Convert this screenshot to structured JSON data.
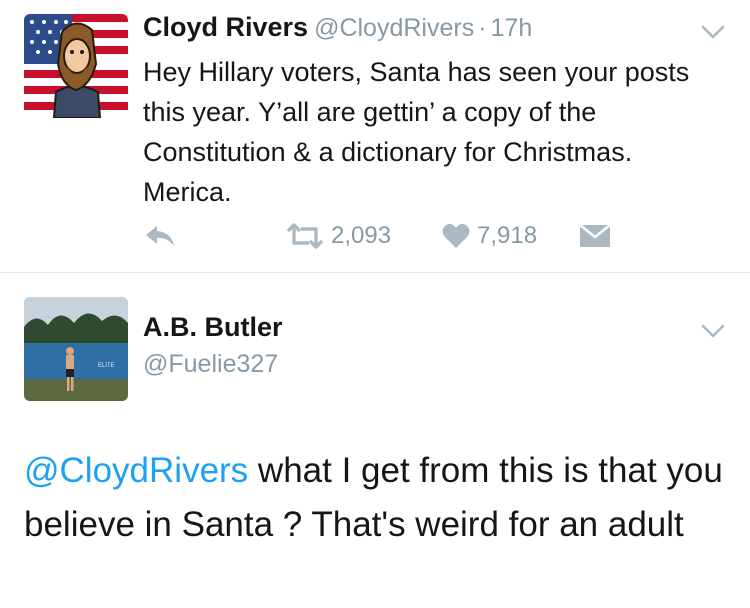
{
  "tweet": {
    "name": "Cloyd Rivers",
    "handle": "@CloydRivers",
    "separator": "·",
    "time": "17h",
    "text": "Hey Hillary voters, Santa has seen your posts this year. Y’all are gettin’ a copy of the Constitution & a dictionary for Christmas. Merica.",
    "actions": {
      "reply_icon": "reply-icon",
      "retweet_icon": "retweet-icon",
      "retweet_count": "2,093",
      "like_icon": "heart-icon",
      "like_count": "7,918",
      "dm_icon": "envelope-icon"
    }
  },
  "reply": {
    "name": "A.B. Butler",
    "handle": "@Fuelie327",
    "mention": "@CloydRivers",
    "text": " what I get from this is that you believe in Santa ? That's weird for an adult"
  },
  "colors": {
    "link": "#1da1f2",
    "secondary": "#8899a6",
    "divider": "#e1e8ed"
  }
}
